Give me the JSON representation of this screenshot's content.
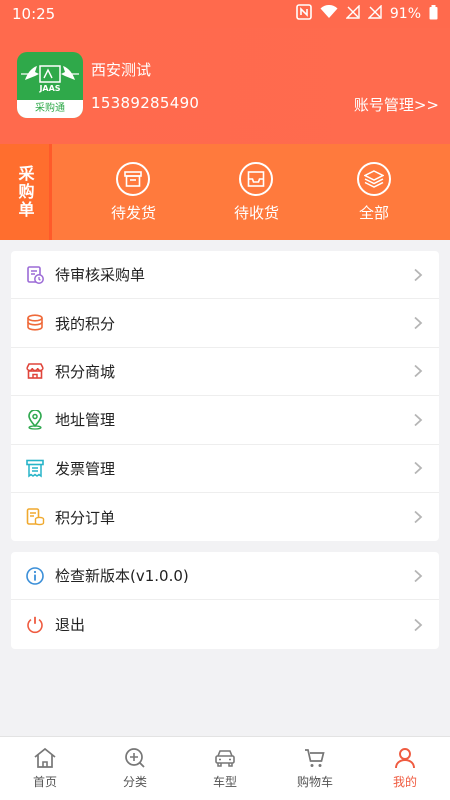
{
  "status": {
    "time": "10:25",
    "battery": "91%"
  },
  "profile": {
    "logo_text": "采购通",
    "logo_brand": "JAAS",
    "name": "西安测试",
    "phone": "15389285490",
    "account_link": "账号管理>>"
  },
  "orders": {
    "label": "采购单",
    "items": [
      {
        "label": "待发货",
        "icon": "box-icon"
      },
      {
        "label": "待收货",
        "icon": "inbox-icon"
      },
      {
        "label": "全部",
        "icon": "layers-icon"
      }
    ]
  },
  "menu": [
    {
      "label": "待审核采购单",
      "icon": "pending-doc-icon",
      "color": "#9b6ad6"
    },
    {
      "label": "我的积分",
      "icon": "coins-stack-icon",
      "color": "#ef6a3a"
    },
    {
      "label": "积分商城",
      "icon": "store-icon",
      "color": "#e0453b"
    },
    {
      "label": "地址管理",
      "icon": "location-icon",
      "color": "#2fa84f"
    },
    {
      "label": "发票管理",
      "icon": "invoice-icon",
      "color": "#27b4c8"
    },
    {
      "label": "积分订单",
      "icon": "points-order-icon",
      "color": "#f0a92e"
    }
  ],
  "menu2": [
    {
      "label": "检查新版本(v1.0.0)",
      "icon": "info-icon",
      "color": "#3b8fd8"
    },
    {
      "label": "退出",
      "icon": "power-icon",
      "color": "#ef5b40"
    }
  ],
  "tabs": [
    {
      "label": "首页",
      "icon": "home-icon"
    },
    {
      "label": "分类",
      "icon": "category-icon"
    },
    {
      "label": "车型",
      "icon": "car-icon"
    },
    {
      "label": "购物车",
      "icon": "cart-icon"
    },
    {
      "label": "我的",
      "icon": "user-icon",
      "active": true
    }
  ],
  "colors": {
    "primary": "#ff6a4d",
    "orders_bg": "#ff7a3d",
    "active_tab": "#ef5b40"
  }
}
